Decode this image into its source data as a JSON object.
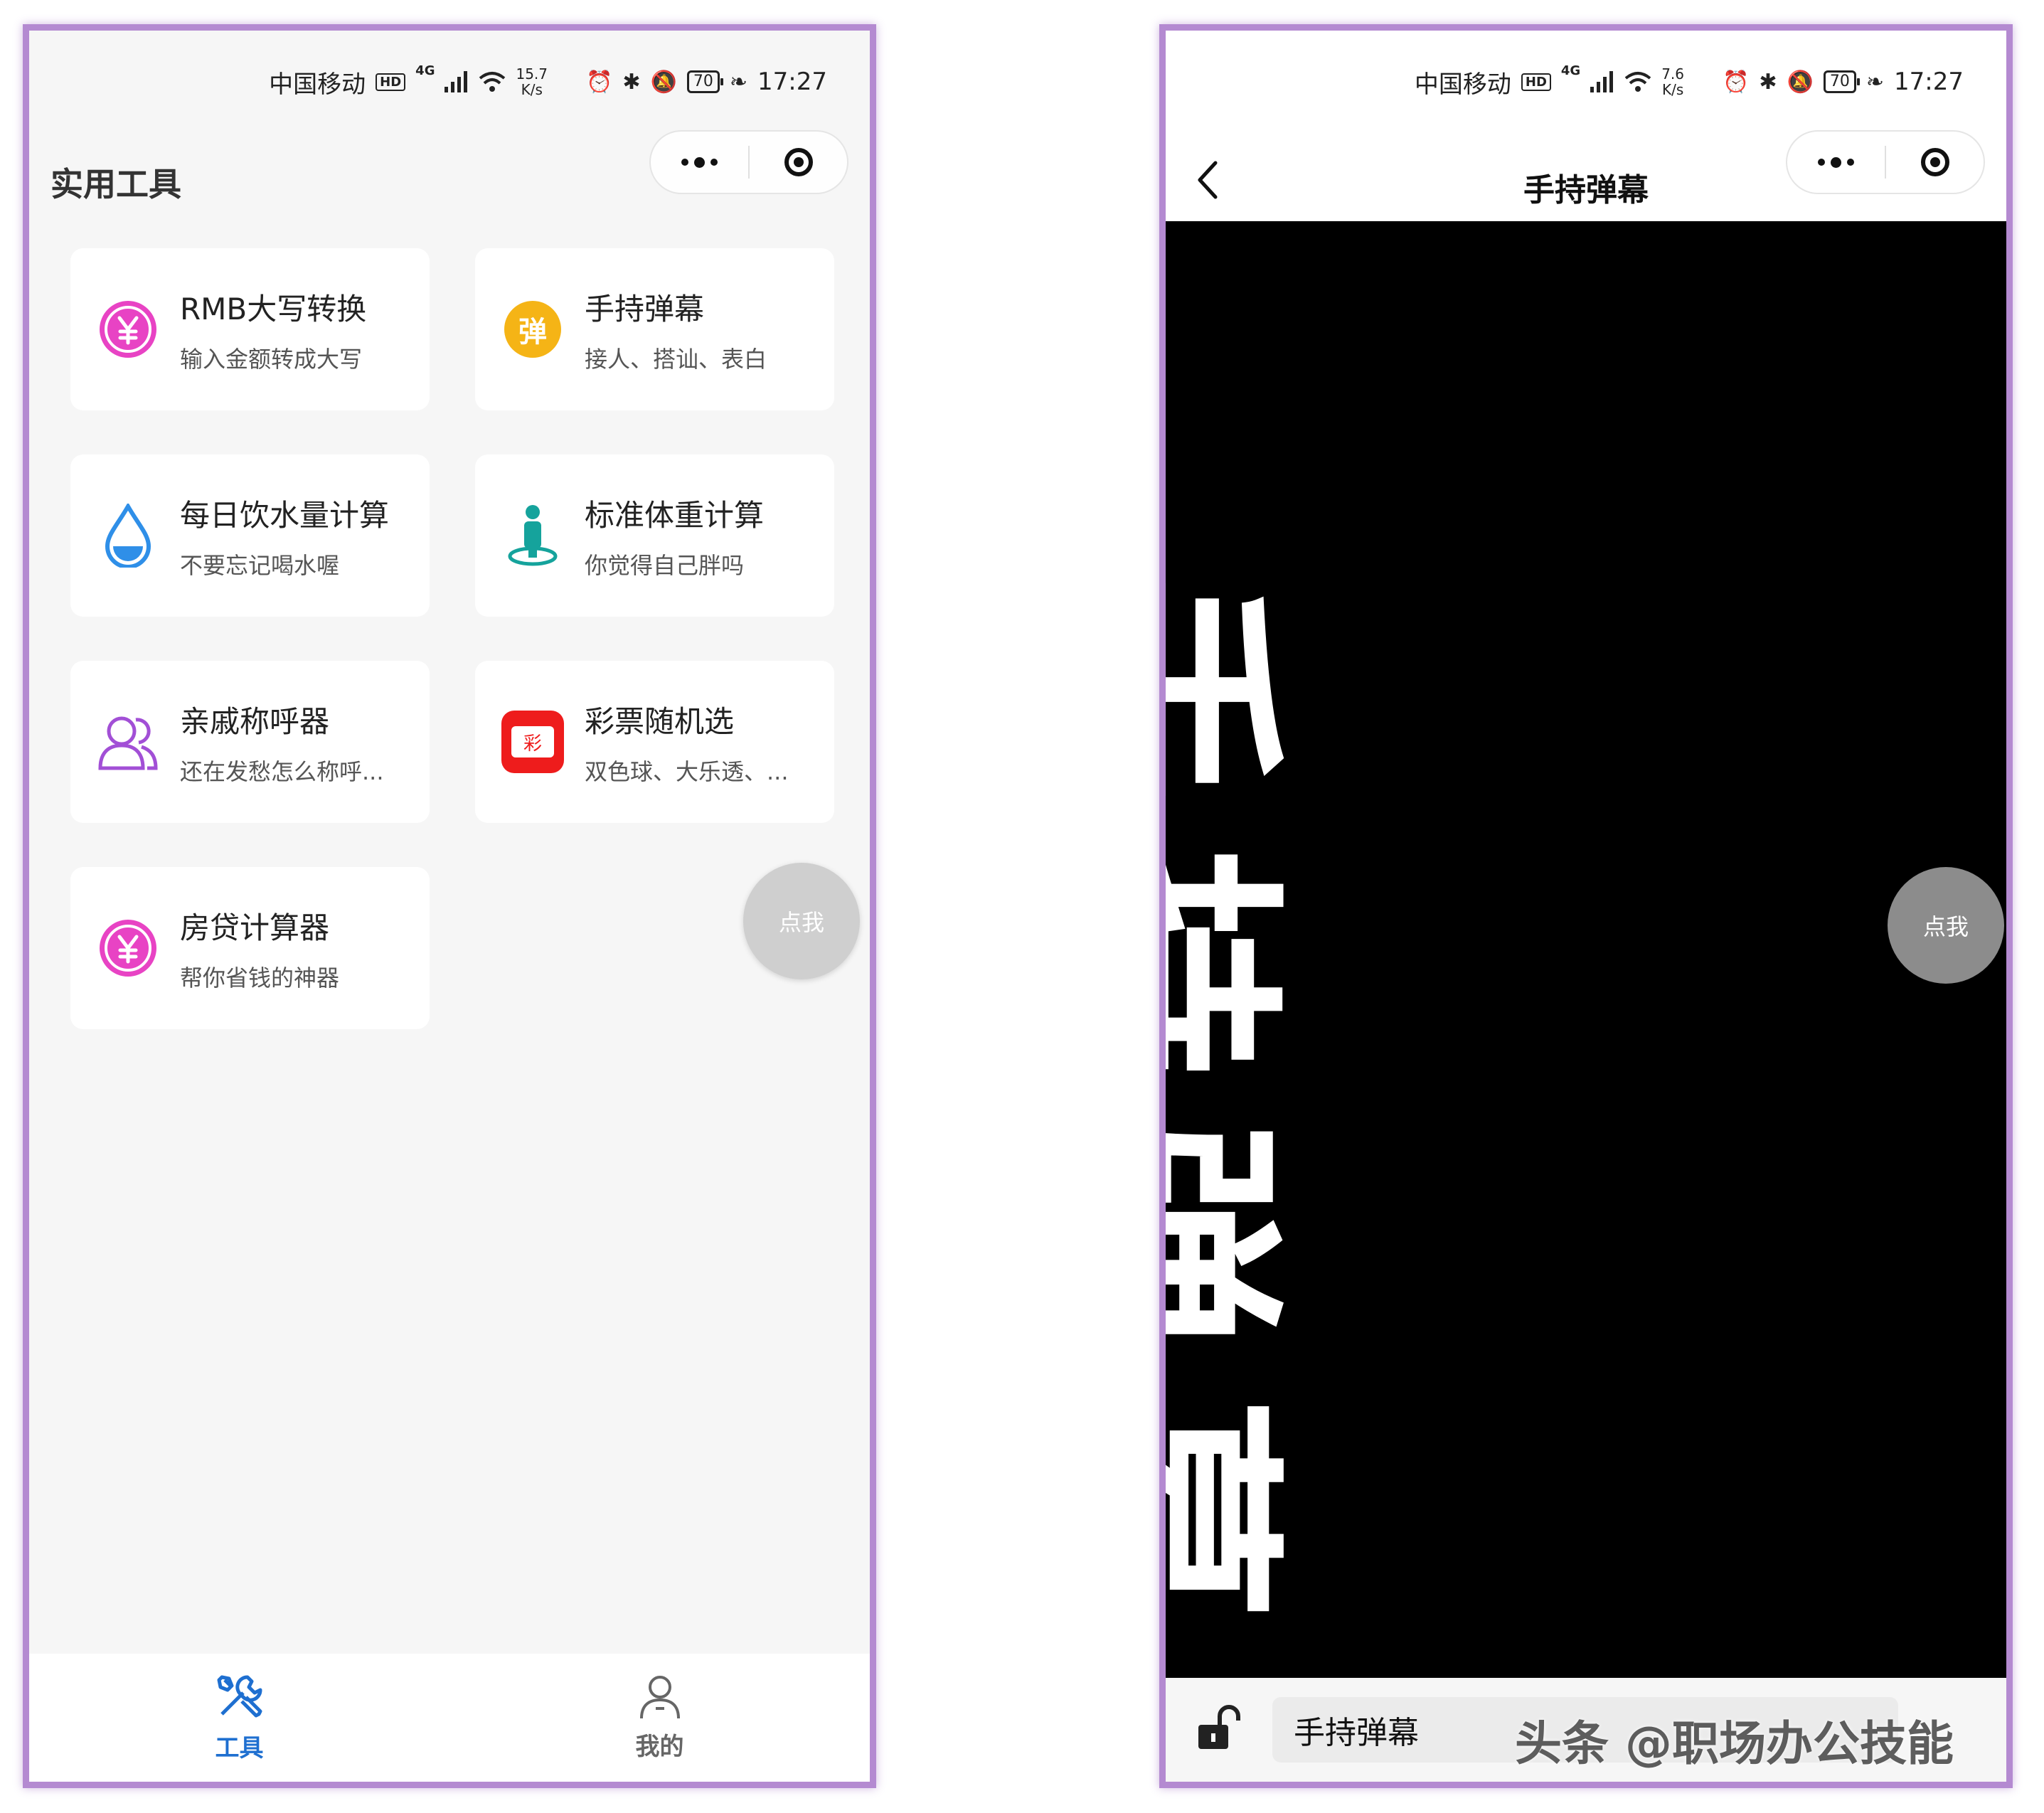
{
  "status_bar": {
    "carrier": "中国移动",
    "hd": "HD",
    "network": "4G",
    "battery": "70",
    "time": "17:27",
    "left_speed_value": "15.7",
    "right_speed_value": "7.6",
    "speed_unit": "K/s"
  },
  "left": {
    "page_title": "实用工具",
    "tools": [
      {
        "name": "RMB大写转换",
        "desc": "输入金额转成大写",
        "icon": "yuan-icon",
        "color": "#e843c4"
      },
      {
        "name": "手持弹幕",
        "desc": "接人、搭讪、表白",
        "icon": "danmu-icon",
        "color": "#f5b416",
        "icon_text": "弹"
      },
      {
        "name": "每日饮水量计算",
        "desc": "不要忘记喝水喔",
        "icon": "water-drop-icon",
        "color": "#2f8fe8"
      },
      {
        "name": "标准体重计算",
        "desc": "你觉得自己胖吗",
        "icon": "person-scale-icon",
        "color": "#15a39c"
      },
      {
        "name": "亲戚称呼器",
        "desc": "还在发愁怎么称呼...",
        "icon": "relatives-icon",
        "color": "#a24fd6"
      },
      {
        "name": "彩票随机选",
        "desc": "双色球、大乐透、...",
        "icon": "lottery-ticket-icon",
        "color": "#ee1c1c",
        "icon_text": "彩"
      },
      {
        "name": "房贷计算器",
        "desc": "帮你省钱的神器",
        "icon": "yuan-icon",
        "color": "#e843c4"
      }
    ],
    "fab_label": "点我",
    "tabs": [
      {
        "label": "工具",
        "icon": "tools-icon",
        "active": true,
        "color": "#1e6fd0"
      },
      {
        "label": "我的",
        "icon": "user-icon",
        "active": false,
        "color": "#666666"
      }
    ]
  },
  "right": {
    "nav_title": "手持弹幕",
    "danmu_text": "手持弹幕",
    "fab_label": "点我",
    "input_value": "手持弹幕",
    "watermark": "头条 @职场办公技能"
  }
}
